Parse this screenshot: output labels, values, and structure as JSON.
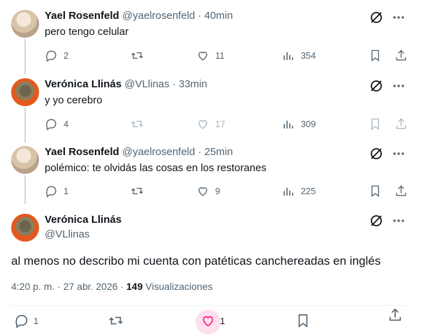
{
  "tweets": [
    {
      "name": "Yael Rosenfeld",
      "handle": "@yaelrosenfeld",
      "time": "· 40min",
      "text": "pero tengo celular",
      "replies": "2",
      "retweets": "",
      "likes": "11",
      "views": "354",
      "disabled": false
    },
    {
      "name": "Verónica Llinás",
      "handle": "@VLlinas",
      "time": "· 33min",
      "text": "y yo cerebro",
      "replies": "4",
      "retweets": "",
      "likes": "17",
      "views": "309",
      "disabled": true
    },
    {
      "name": "Yael Rosenfeld",
      "handle": "@yaelrosenfeld",
      "time": "· 25min",
      "text": "polémico: te olvidás las cosas en los restoranes",
      "replies": "1",
      "retweets": "",
      "likes": "9",
      "views": "225",
      "disabled": false
    }
  ],
  "main": {
    "name": "Verónica Llinás",
    "handle": "@VLlinas",
    "text": "al menos no describo mi cuenta con patéticas canchereadas en inglés",
    "datetime": "4:20 p. m. · 27 abr. 2026 · ",
    "views_count": "149",
    "views_label": " Visualizaciones",
    "replies": "1",
    "likes": "1"
  },
  "icons": {
    "grok": "grok-icon",
    "more": "more-icon",
    "reply": "reply-icon",
    "retweet": "retweet-icon",
    "like": "heart-icon",
    "views": "views-icon",
    "bookmark": "bookmark-icon",
    "share": "share-icon"
  },
  "colors": {
    "text": "#0f1419",
    "secondary": "#536471",
    "like_bg": "#fde0ec",
    "like_stroke": "#f91880"
  }
}
